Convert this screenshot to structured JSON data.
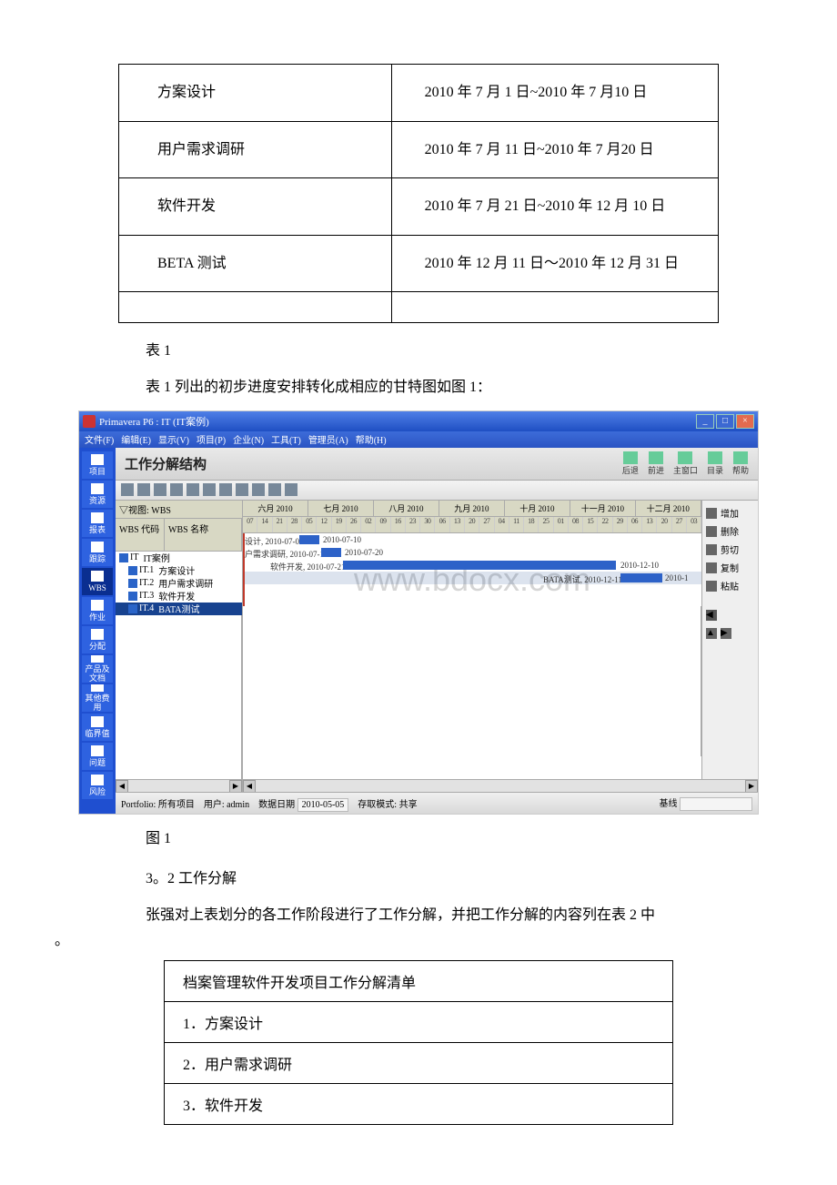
{
  "phase_table": {
    "rows": [
      {
        "phase": "方案设计",
        "period": "2010 年 7 月 1 日~2010 年 7 月10 日"
      },
      {
        "phase": "用户需求调研",
        "period": "2010 年 7 月 11 日~2010 年 7 月20 日"
      },
      {
        "phase": "软件开发",
        "period": "2010 年 7 月 21 日~2010 年 12 月 10 日"
      },
      {
        "phase": "BETA 测试",
        "period": "2010 年 12 月 11 日～2010 年 12 月 31 日"
      }
    ]
  },
  "captions": {
    "table1": "表 1",
    "table1_desc": "表 1 列出的初步进度安排转化成相应的甘特图如图 1：",
    "fig1": "图 1",
    "sec32": "3。2 工作分解",
    "sec32_para": "张强对上表划分的各工作阶段进行了工作分解，并把工作分解的内容列在表 2 中",
    "sec32_tail": "。"
  },
  "breakdown": {
    "title": "档案管理软件开发项目工作分解清单",
    "items": [
      "1．方案设计",
      "2．用户需求调研",
      "3．软件开发"
    ]
  },
  "window": {
    "title": "Primavera P6 : IT (IT案例)",
    "menus": [
      "文件(F)",
      "编辑(E)",
      "显示(V)",
      "项目(P)",
      "企业(N)",
      "工具(T)",
      "管理员(A)",
      "帮助(H)"
    ],
    "panel_title": "工作分解结构",
    "head_buttons": [
      {
        "icon": "back",
        "label": "后退"
      },
      {
        "icon": "fwd",
        "label": "前进"
      },
      {
        "icon": "home",
        "label": "主窗口"
      },
      {
        "icon": "dir",
        "label": "目录"
      },
      {
        "icon": "help",
        "label": "帮助"
      }
    ],
    "leftbar": [
      "项目",
      "资源",
      "报表",
      "跟踪",
      "WBS",
      "作业",
      "分配",
      "产品及文档",
      "其他费用",
      "临界值",
      "问题",
      "风险"
    ],
    "wbs": {
      "col1": "WBS 代码",
      "col2": "WBS 名称",
      "view_label": "▽视图: WBS",
      "rows": [
        {
          "code": "IT",
          "name": "IT案例"
        },
        {
          "code": "IT.1",
          "name": "方案设计"
        },
        {
          "code": "IT.2",
          "name": "用户需求调研"
        },
        {
          "code": "IT.3",
          "name": "软件开发"
        },
        {
          "code": "IT.4",
          "name": "BATA测试"
        }
      ]
    },
    "months": [
      "六月 2010",
      "七月 2010",
      "八月 2010",
      "九月 2010",
      "十月 2010",
      "十一月 2010",
      "十二月 2010"
    ],
    "days": [
      "07",
      "14",
      "21",
      "28",
      "05",
      "12",
      "19",
      "26",
      "02",
      "09",
      "16",
      "23",
      "30",
      "06",
      "13",
      "20",
      "27",
      "04",
      "11",
      "18",
      "25",
      "01",
      "08",
      "15",
      "22",
      "29",
      "06",
      "13",
      "20",
      "27",
      "03"
    ],
    "bar_labels": {
      "it1": "设计, 2010-07-01",
      "it1e": "2010-07-10",
      "it2": "户需求调研, 2010-07-11",
      "it2e": "2010-07-20",
      "it3": "软件开发, 2010-07-21",
      "it3e": "2010-12-10",
      "it4": "BATA测试, 2010-12-11",
      "it4e": "2010-1"
    },
    "right_actions": [
      {
        "icon": "add",
        "label": "增加"
      },
      {
        "icon": "del",
        "label": "删除"
      },
      {
        "icon": "cut",
        "label": "剪切"
      },
      {
        "icon": "copy",
        "label": "复制"
      },
      {
        "icon": "paste",
        "label": "粘贴"
      }
    ],
    "status": {
      "portfolio_label": "Portfolio: 所有项目",
      "user_label": "用户: admin",
      "date_label": "数据日期",
      "date_val": "2010-05-05",
      "mode_label": "存取模式: 共享",
      "baseline": "基线"
    },
    "watermark": "www.bdocx.com"
  }
}
